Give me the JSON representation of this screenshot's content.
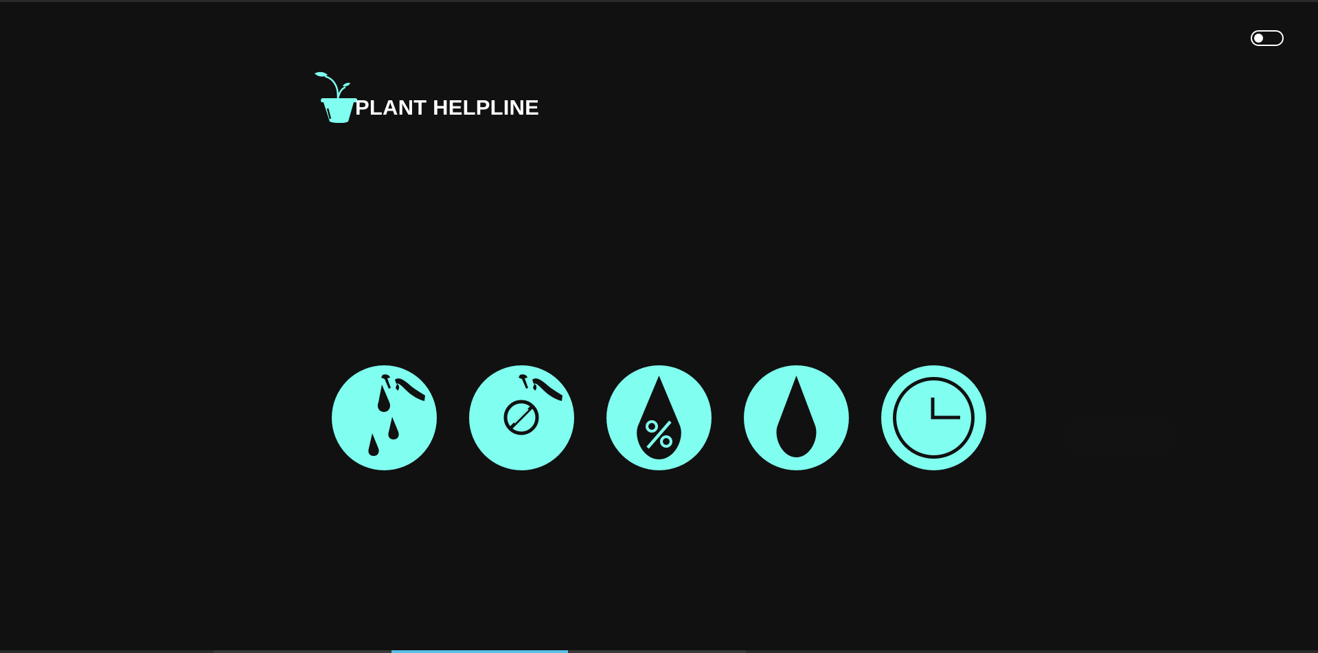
{
  "header": {
    "title": "PLANT HELPLINE",
    "logo_icon": "plant-pot-icon"
  },
  "theme_toggle": {
    "state": "off",
    "icon": "toggle-switch-icon"
  },
  "features": [
    {
      "icon": "watering-can-drops-icon",
      "label": ""
    },
    {
      "icon": "watering-can-prohibited-icon",
      "label": ""
    },
    {
      "icon": "humidity-percent-drop-icon",
      "label": ""
    },
    {
      "icon": "water-drop-icon",
      "label": ""
    },
    {
      "icon": "clock-icon",
      "label": ""
    }
  ],
  "colors": {
    "background": "#111111",
    "accent": "#80fff0",
    "text": "#ffffff",
    "icon_dark": "#111111"
  },
  "bottom_strip": {
    "active_segment": 2,
    "segment_colors": [
      "#3a3a3a",
      "#58c0e6",
      "#3a3a3a"
    ]
  }
}
